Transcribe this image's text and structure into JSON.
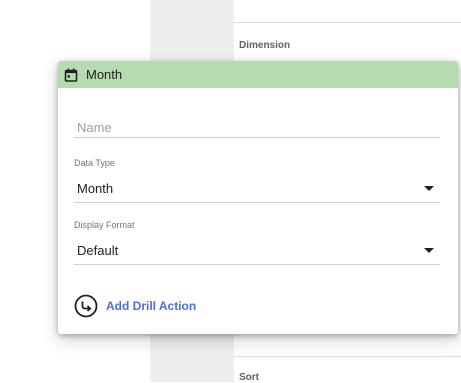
{
  "background": {
    "dimension_label": "Dimension",
    "sort_label": "Sort"
  },
  "dialog": {
    "title": "Month",
    "title_icon": "calendar-icon",
    "header_color": "#b7dbb0",
    "name_field": {
      "placeholder": "Name",
      "value": ""
    },
    "data_type": {
      "caption": "Data Type",
      "value": "Month"
    },
    "display_format": {
      "caption": "Display Format",
      "value": "Default"
    },
    "add_drill_action": {
      "label": "Add Drill Action",
      "icon": "drill-return-arrow-icon",
      "color": "#4a6ee0"
    }
  }
}
